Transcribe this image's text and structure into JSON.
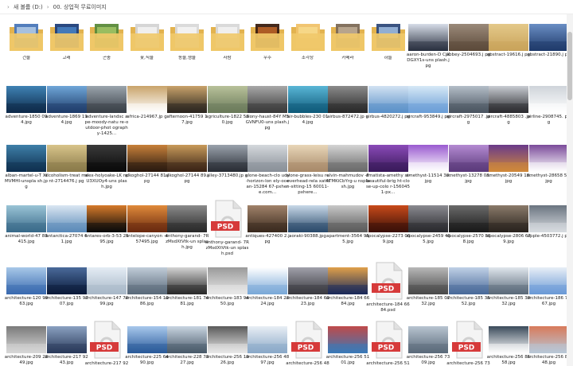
{
  "breadcrumb": {
    "drive": "새 볼륨 (D:)",
    "folder": "00. 상업적 무료이미지"
  },
  "rows": [
    [
      {
        "label": "건물",
        "kind": "folder",
        "c1": "#4a77b8",
        "c2": "#bcd2ea"
      },
      {
        "label": "고래",
        "kind": "folder",
        "c1": "#1f3f7a",
        "c2": "#4a86c8"
      },
      {
        "label": "곤충",
        "kind": "folder",
        "c1": "#5a8a3a",
        "c2": "#a7c96a"
      },
      {
        "label": "꽃,식물",
        "kind": "folder",
        "c1": "#d4d4d4",
        "c2": "#f6f6f6"
      },
      {
        "label": "동물,생물",
        "kind": "folder",
        "c1": "#d9d9d9",
        "c2": "#f7f7f7"
      },
      {
        "label": "사람",
        "kind": "folder",
        "c1": "#d8d8d8",
        "c2": "#f5f5f5"
      },
      {
        "label": "우주",
        "kind": "folder",
        "c1": "#3a1d10",
        "c2": "#c86a2a"
      },
      {
        "label": "조각상",
        "kind": "folder",
        "c1": "#f0c26a",
        "c2": "#f8dc8f"
      },
      {
        "label": "카메라",
        "kind": "folder",
        "c1": "#7d6a56",
        "c2": "#c4b19a"
      },
      {
        "label": "하늘",
        "kind": "folder",
        "c1": "#2f4a7a",
        "c2": "#a8c6e8"
      },
      {
        "label": "aaron-burden-D CjXDGXY1s-uns plash.jpg",
        "kind": "photo",
        "c1": "#2a3140",
        "c2": "#d7dde8"
      },
      {
        "label": "abbey-2504693.j pg",
        "kind": "photo",
        "c1": "#5c4a3a",
        "c2": "#9b8a7a"
      },
      {
        "label": "abstract-19616.j pg",
        "kind": "photo",
        "c1": "#c9a35a",
        "c2": "#e4c98a"
      },
      {
        "label": "abstract-21890.j pg",
        "kind": "photo",
        "c1": "#1f3a6a",
        "c2": "#6a8ec4"
      }
    ],
    [
      {
        "label": "adventure-1850 094.jpg",
        "kind": "photo",
        "c1": "#0e2a4a",
        "c2": "#3f82b4"
      },
      {
        "label": "adventure-1869 194.jpg",
        "kind": "photo",
        "c1": "#1e3c6a",
        "c2": "#6fa6d8"
      },
      {
        "label": "adventure-landsc ape-moody-natu re-outdoor-phot ography-1425...",
        "kind": "photo",
        "c1": "#3a4048",
        "c2": "#9aa4ac"
      },
      {
        "label": "africa-214967.jp g",
        "kind": "photo",
        "c1": "#ffffff",
        "c2": "#c9a46a"
      },
      {
        "label": "afternoon-41759 17.jpg",
        "kind": "photo",
        "c1": "#2a2620",
        "c2": "#c9a26a"
      },
      {
        "label": "agriculture-1822 530.jpg",
        "kind": "photo",
        "c1": "#6a7a5a",
        "c2": "#b8c19a"
      },
      {
        "label": "aiony-haust-84Y M5GVNFU0-uns plash.jpg",
        "kind": "photo",
        "c1": "#3a3a3a",
        "c2": "#a8a8a8"
      },
      {
        "label": "air-bubbles-230 014.jpg",
        "kind": "photo",
        "c1": "#0f5a7a",
        "c2": "#59b6d6"
      },
      {
        "label": "airbus-872472.jp g",
        "kind": "photo",
        "c1": "#2a2a2a",
        "c2": "#8a8a8a"
      },
      {
        "label": "airbus-4820272.j pg",
        "kind": "photo",
        "c1": "#5a90c8",
        "c2": "#d2e2f2"
      },
      {
        "label": "aircraft-953849.j pg",
        "kind": "photo",
        "c1": "#6a9ed6",
        "c2": "#d6e8f6"
      },
      {
        "label": "aircraft-2975017 .jpg",
        "kind": "photo",
        "c1": "#4a5460",
        "c2": "#b4bec8"
      },
      {
        "label": "aircraft-4885803 .jpg",
        "kind": "photo",
        "c1": "#2a2a2e",
        "c2": "#c8ccd2"
      },
      {
        "label": "airline-2908745. png",
        "kind": "photo",
        "c1": "#ffffff",
        "c2": "#cfd4da"
      }
    ],
    [
      {
        "label": "alban-martel-u-T XtMVMHI-unspla sh.jpg",
        "kind": "photo",
        "c1": "#0f3050",
        "c2": "#3e7fa8"
      },
      {
        "label": "alcoholism-treat ment-2714476.j pg",
        "kind": "photo",
        "c1": "#8a7a4a",
        "c2": "#d8c48a"
      },
      {
        "label": "alex-holyoake-LK npU3XUOy4-uns plash.jpg",
        "kind": "photo",
        "c1": "#0a0a0a",
        "c2": "#3a3a3a"
      },
      {
        "label": "alkoghol-27144 81.jpg",
        "kind": "photo",
        "c1": "#2a1a10",
        "c2": "#c8803a"
      },
      {
        "label": "alkoghol-27144 89.jpg",
        "kind": "photo",
        "c1": "#3a2416",
        "c2": "#c89a5a"
      },
      {
        "label": "alley-3713480.jp g",
        "kind": "photo",
        "c1": "#2a2e36",
        "c2": "#9aa2ac"
      },
      {
        "label": "alone-beach-clo udy-horizon-lon ely-ocean-15284 67-pxhere.com...",
        "kind": "photo",
        "c1": "#8a9098",
        "c2": "#d4d8dc"
      },
      {
        "label": "alone-grass-leisu re-overhead-rela xation-sitting-15 60011-pxhere...",
        "kind": "photo",
        "c1": "#a88a6a",
        "c2": "#e8d6b8"
      },
      {
        "label": "alvin-mahmudov -F4TMKiCbYrg-u nsplash.jpg",
        "kind": "photo",
        "c1": "#6a6a6a",
        "c2": "#d4d4d4"
      },
      {
        "label": "amatista-amethy st-beautiful-brig ht-close-up-colo r-1560451-px...",
        "kind": "photo",
        "c1": "#3a1a5a",
        "c2": "#8a4ab8"
      },
      {
        "label": "amethyst-11514 30.jpg",
        "kind": "photo",
        "c1": "#ffffff",
        "c2": "#9a5ad0"
      },
      {
        "label": "amethyst-13278 03.jpg",
        "kind": "photo",
        "c1": "#5a3a7a",
        "c2": "#b48ad2"
      },
      {
        "label": "amethyst-20549 18.jpg",
        "kind": "photo",
        "c1": "#d08a3a",
        "c2": "#6a3a8a"
      },
      {
        "label": "amethyst-28658 57.jpg",
        "kind": "photo",
        "c1": "#ffffff",
        "c2": "#7a4a9a"
      }
    ],
    [
      {
        "label": "animal-world-47 88415.jpg",
        "kind": "photo",
        "c1": "#3a6a8a",
        "c2": "#9ac4d6"
      },
      {
        "label": "antarctica-27074 61.jpg",
        "kind": "photo",
        "c1": "#5a8ab8",
        "c2": "#dae6f2"
      },
      {
        "label": "antares-orb-3-53 2595.jpg",
        "kind": "photo",
        "c1": "#0a0a0a",
        "c2": "#d67a2a"
      },
      {
        "label": "antelope-canyon -457495.jpg",
        "kind": "photo",
        "c1": "#6a2a10",
        "c2": "#e08a3a"
      },
      {
        "label": "anthony-garand- 7RzMsdXtVtk-un splash.jpg",
        "kind": "photo",
        "c1": "#2a2a2a",
        "c2": "#8a8a8a"
      },
      {
        "label": "anthony-garand- 7RzMsdXtVtk-un splash.psd",
        "kind": "psd",
        "c1": "#d63a3a",
        "c2": "#ececec"
      },
      {
        "label": "antiques-427400 2.jpg",
        "kind": "photo",
        "c1": "#3a2a1e",
        "c2": "#a0826a"
      },
      {
        "label": "aoraki-90388.jpg",
        "kind": "photo",
        "c1": "#2a4a6a",
        "c2": "#c8d8e8"
      },
      {
        "label": "apartment-3564 955.jpg",
        "kind": "photo",
        "c1": "#5a5a5a",
        "c2": "#c8c8c8"
      },
      {
        "label": "apocalypse-2273 069.jpg",
        "kind": "photo",
        "c1": "#3a1008",
        "c2": "#c84a1a"
      },
      {
        "label": "apocalypse-2459 465.jpg",
        "kind": "photo",
        "c1": "#2a2a2e",
        "c2": "#8a8a90"
      },
      {
        "label": "apocalypse-2570 868.jpg",
        "kind": "photo",
        "c1": "#1a1a1a",
        "c2": "#6a6a6a"
      },
      {
        "label": "apocalypse-2806 679.jpg",
        "kind": "photo",
        "c1": "#2a241e",
        "c2": "#8a7a6a"
      },
      {
        "label": "apple-4503772.j pg",
        "kind": "photo",
        "c1": "#d8dce0",
        "c2": "#6a7480"
      }
    ],
    [
      {
        "label": "architecture-120 9963.jpg",
        "kind": "photo",
        "c1": "#3a6ab0",
        "c2": "#a8c8e8"
      },
      {
        "label": "architecture-135 9707.jpg",
        "kind": "photo",
        "c1": "#0a1a3a",
        "c2": "#4a6a9a"
      },
      {
        "label": "architecture-147 7099.jpg",
        "kind": "photo",
        "c1": "#a8b8c8",
        "c2": "#e4ecf4"
      },
      {
        "label": "architecture-154 1086.jpg",
        "kind": "photo",
        "c1": "#5a6a7a",
        "c2": "#c0ccd8"
      },
      {
        "label": "architecture-181 7481.jpg",
        "kind": "photo",
        "c1": "#2a2a2a",
        "c2": "#d4d4d4"
      },
      {
        "label": "architecture-183 9450.jpg",
        "kind": "photo",
        "c1": "#e8e8e8",
        "c2": "#9a9a9a"
      },
      {
        "label": "architecture-184 2324.jpg",
        "kind": "photo",
        "c1": "#7aa8d8",
        "c2": "#ffffff"
      },
      {
        "label": "architecture-184 6023.jpg",
        "kind": "photo",
        "c1": "#3a3a40",
        "c2": "#a0a0aa"
      },
      {
        "label": "architecture-184 6684.jpg",
        "kind": "photo",
        "c1": "#1a2a5a",
        "c2": "#e0a04a"
      },
      {
        "label": "architecture-184 6684.psd",
        "kind": "psd",
        "c1": "#d63a3a",
        "c2": "#ececec"
      },
      {
        "label": "architecture-185 0732.jpg",
        "kind": "photo",
        "c1": "#4a4a4a",
        "c2": "#b8b8b8"
      },
      {
        "label": "architecture-185 3552.jpg",
        "kind": "photo",
        "c1": "#4a6a9a",
        "c2": "#c0d0e6"
      },
      {
        "label": "architecture-185 3932.jpg",
        "kind": "photo",
        "c1": "#5a6a7a",
        "c2": "#e0e6ec"
      },
      {
        "label": "architecture-186 7567.jpg",
        "kind": "photo",
        "c1": "#6a9ad6",
        "c2": "#e8eef6"
      }
    ],
    [
      {
        "label": "architecture-209 2849.jpg",
        "kind": "photo",
        "c1": "#d8d8d8",
        "c2": "#7a7a7a"
      },
      {
        "label": "architecture-217 9243.jpg",
        "kind": "photo",
        "c1": "#2a3a5a",
        "c2": "#8aa0c0"
      },
      {
        "label": "architecture-217 9243.psd",
        "kind": "psd",
        "c1": "#d63a3a",
        "c2": "#ececec"
      },
      {
        "label": "architecture-225 6490.jpg",
        "kind": "photo",
        "c1": "#2a5a9a",
        "c2": "#a8c8ec"
      },
      {
        "label": "architecture-228 7327.jpg",
        "kind": "photo",
        "c1": "#4a5a6a",
        "c2": "#c8d4e0"
      },
      {
        "label": "architecture-256 1926.jpg",
        "kind": "photo",
        "c1": "#e8e8e8",
        "c2": "#5a5a5a"
      },
      {
        "label": "architecture-256 4897.jpg",
        "kind": "photo",
        "c1": "#8aa8c8",
        "c2": "#e8eef4"
      },
      {
        "label": "architecture-256 4897.psd",
        "kind": "psd",
        "c1": "#d63a3a",
        "c2": "#ececec"
      },
      {
        "label": "architecture-256 5101.jpg",
        "kind": "photo",
        "c1": "#3a7ab8",
        "c2": "#c04a4a"
      },
      {
        "label": "architecture-256 5101.psd",
        "kind": "psd",
        "c1": "#d63a3a",
        "c2": "#ececec"
      },
      {
        "label": "architecture-256 7309.jpg",
        "kind": "photo",
        "c1": "#5a6a7a",
        "c2": "#b8c4d0"
      },
      {
        "label": "architecture-256 7309.psd",
        "kind": "psd",
        "c1": "#d63a3a",
        "c2": "#ececec"
      },
      {
        "label": "architecture-256 8558.jpg",
        "kind": "photo",
        "c1": "#ffffff",
        "c2": "#3a4a5a"
      },
      {
        "label": "architecture-256 8948.jpg",
        "kind": "photo",
        "c1": "#b8c8d8",
        "c2": "#d87a5a"
      }
    ]
  ],
  "badges": {
    "psd": "PSD"
  },
  "colors": {
    "folder": "#f0c96a",
    "folder_dark": "#e3b34f",
    "selection": "#cce8ff"
  }
}
